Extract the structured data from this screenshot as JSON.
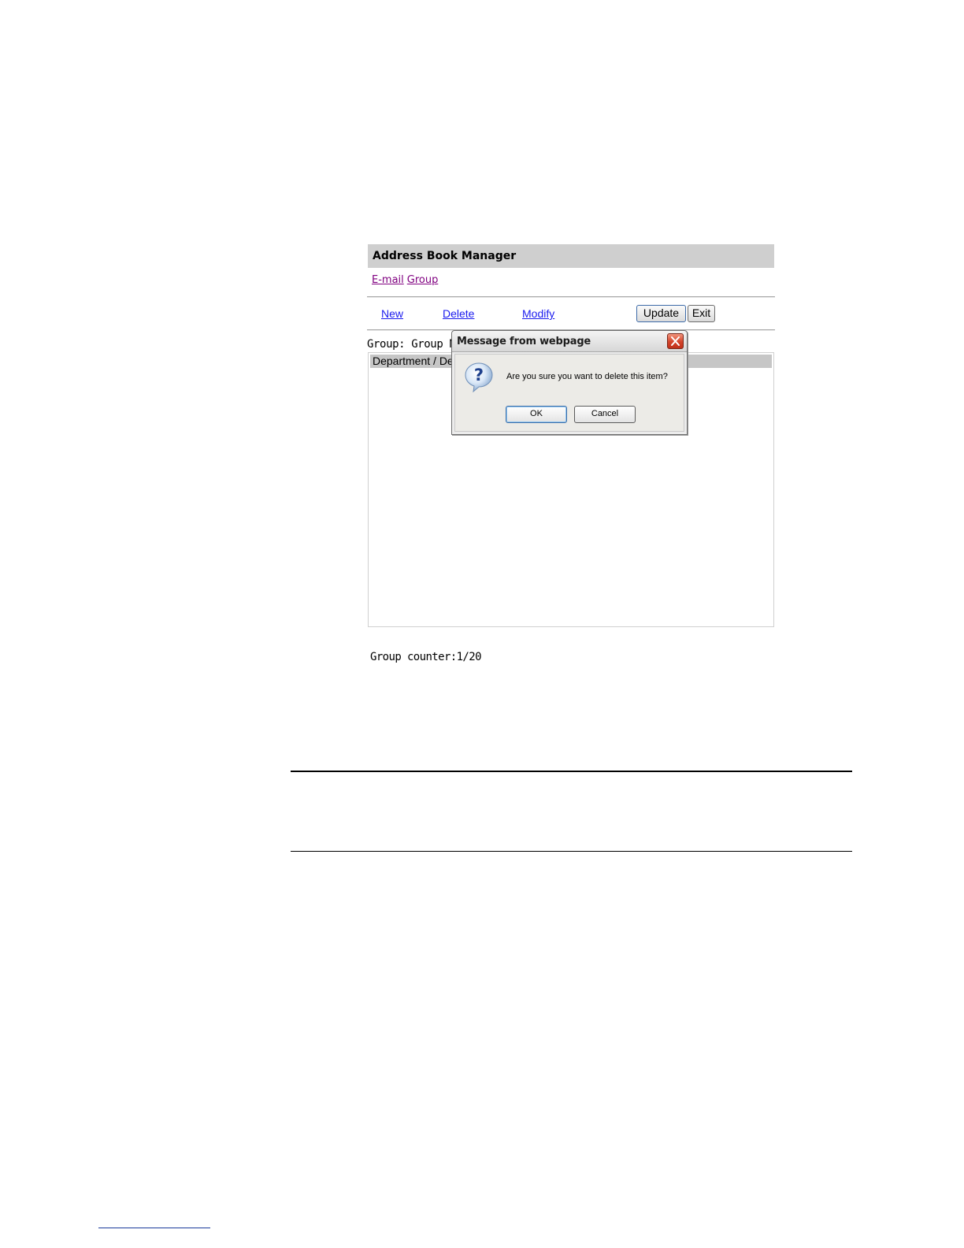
{
  "app": {
    "title": "Address Book Manager",
    "nav_links": [
      "E-mail",
      "Group"
    ],
    "toolbar": {
      "new_label": "New",
      "delete_label": "Delete",
      "modify_label": "Modify",
      "update_label": "Update",
      "exit_label": "Exit"
    },
    "group_label": "Group: Group Name",
    "list_header": "Department / Description",
    "counter": "Group counter:1/20"
  },
  "dialog": {
    "title": "Message from webpage",
    "icon": "question-icon",
    "message": "Are you sure you want to delete this item?",
    "ok_label": "OK",
    "cancel_label": "Cancel"
  },
  "colors": {
    "visited_link": "#800080",
    "link": "#1a1aee",
    "title_bar": "#cfcfcf",
    "close_button": "#d2432a"
  }
}
